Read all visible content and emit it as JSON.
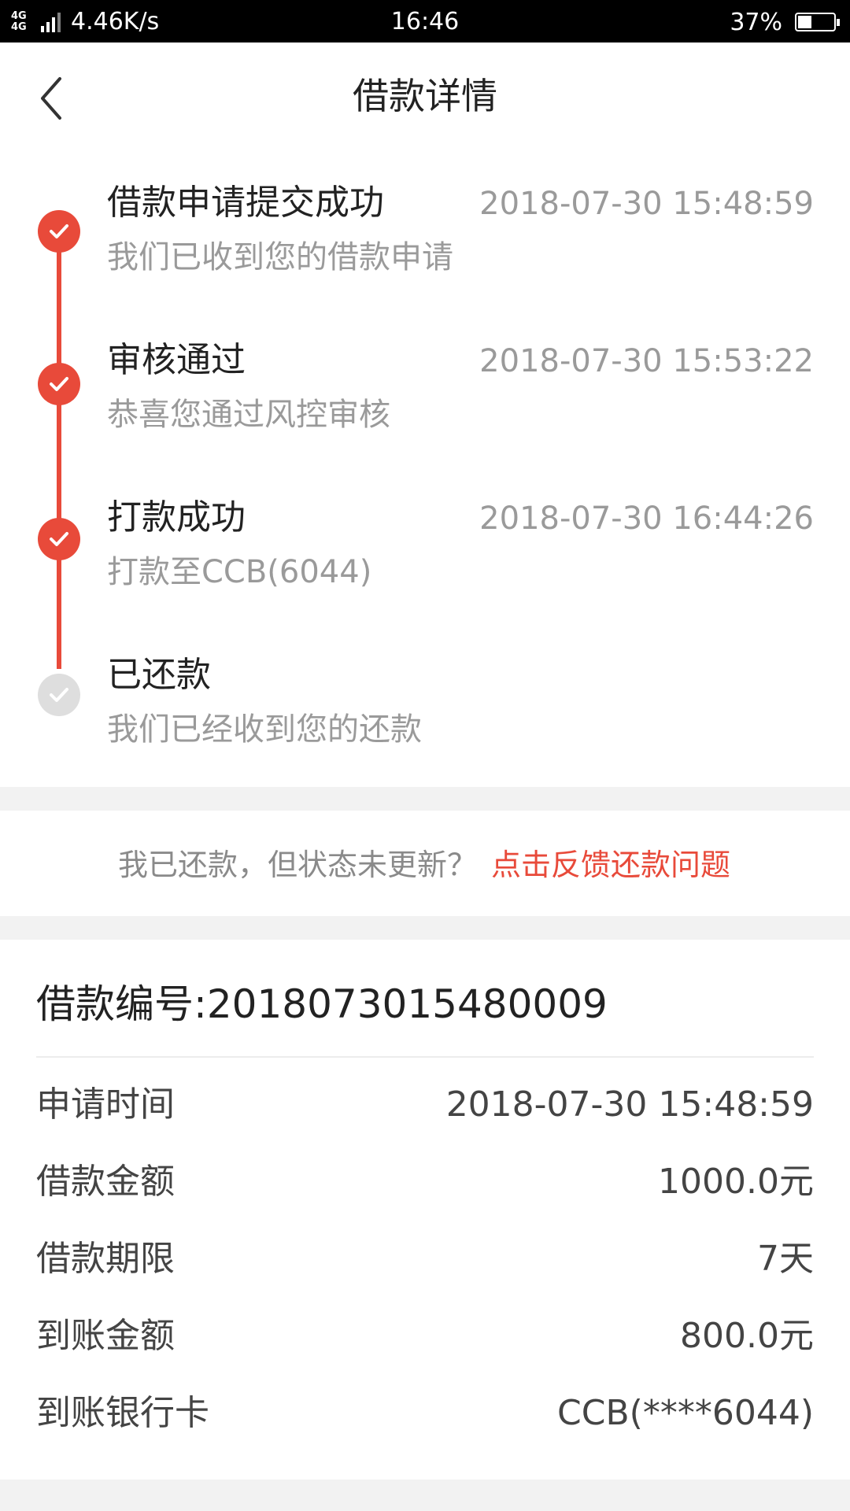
{
  "status_bar": {
    "network": "4G 4G",
    "speed": "4.46K/s",
    "time": "16:46",
    "battery": "37%"
  },
  "header": {
    "back_icon": "chevron-left-icon",
    "title": "借款详情"
  },
  "timeline": {
    "colors": {
      "active": "#e84a3a",
      "pending": "#dedede"
    },
    "steps": [
      {
        "title": "借款申请提交成功",
        "time": "2018-07-30 15:48:59",
        "desc": "我们已收到您的借款申请",
        "status": "done"
      },
      {
        "title": "审核通过",
        "time": "2018-07-30 15:53:22",
        "desc": "恭喜您通过风控审核",
        "status": "done"
      },
      {
        "title": "打款成功",
        "time": "2018-07-30 16:44:26",
        "desc": "打款至CCB(6044)",
        "status": "done"
      },
      {
        "title": "已还款",
        "time": "",
        "desc": "我们已经收到您的还款",
        "status": "pending"
      }
    ]
  },
  "feedback": {
    "question": "我已还款，但状态未更新？",
    "link": "点击反馈还款问题"
  },
  "details": {
    "loan_no": "借款编号:2018073015480009",
    "rows": [
      {
        "label": "申请时间",
        "value": "2018-07-30 15:48:59"
      },
      {
        "label": "借款金额",
        "value": "1000.0元"
      },
      {
        "label": "借款期限",
        "value": "7天"
      },
      {
        "label": "到账金额",
        "value": "800.0元"
      },
      {
        "label": "到账银行卡",
        "value": "CCB(****6044)"
      }
    ]
  }
}
